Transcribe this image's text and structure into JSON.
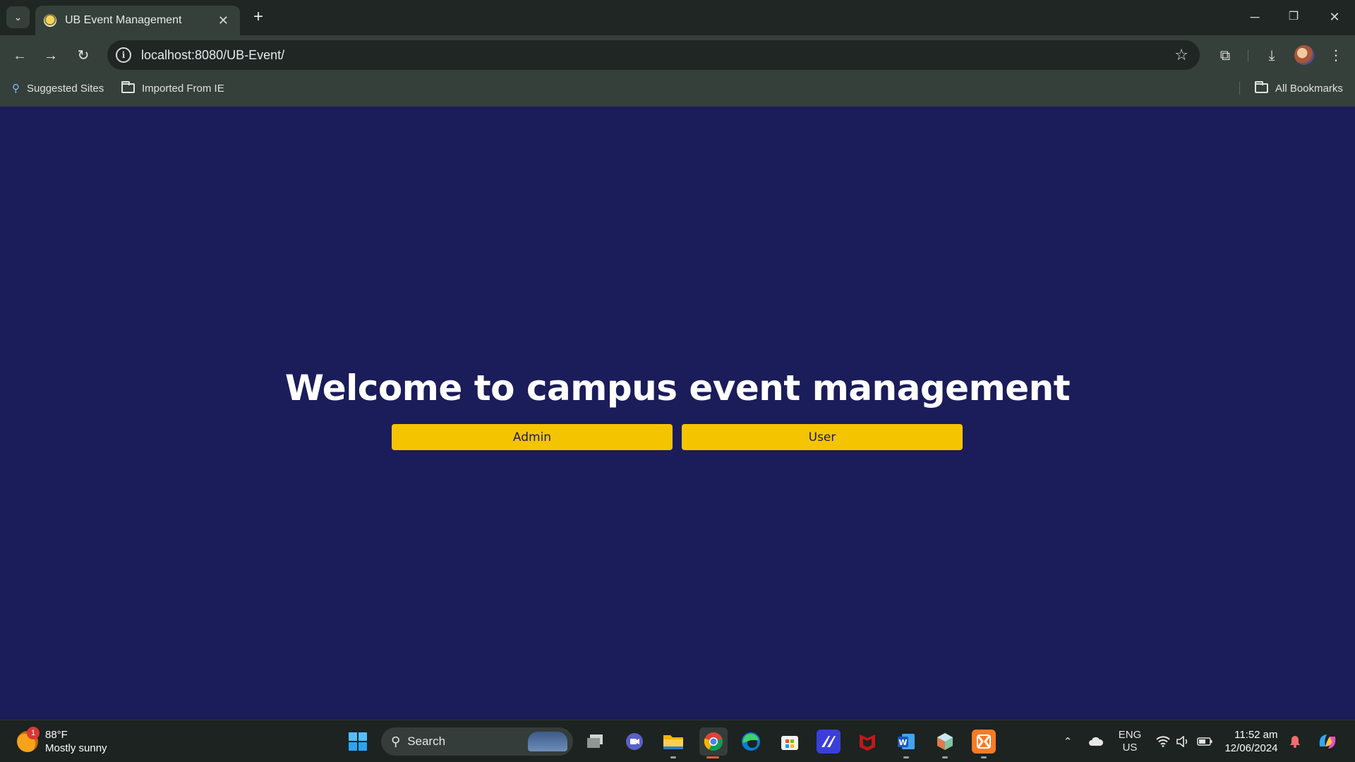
{
  "browser": {
    "tab_title": "UB Event Management",
    "tab_close": "✕",
    "new_tab": "+",
    "url": "localhost:8080/UB-Event/",
    "bookmarks": [
      "Suggested Sites",
      "Imported From IE"
    ],
    "all_bookmarks": "All Bookmarks",
    "window_controls": {
      "minimize": "─",
      "restore": "❐",
      "close": "✕"
    }
  },
  "page": {
    "title": "Welcome to campus event management",
    "buttons": {
      "admin": "Admin",
      "user": "User"
    },
    "colors": {
      "background": "#1b1c5a",
      "button": "#f5c400",
      "title": "#ffffff"
    }
  },
  "taskbar": {
    "weather": {
      "temp": "88°F",
      "condition": "Mostly sunny",
      "badge": "1"
    },
    "search_label": "Search",
    "language": {
      "line1": "ENG",
      "line2": "US"
    },
    "clock": {
      "time": "11:52 am",
      "date": "12/06/2024"
    },
    "apps": [
      "windows-start",
      "search",
      "task-view",
      "meet",
      "file-explorer",
      "chrome",
      "edge",
      "microsoft-store",
      "visual-studio",
      "mcafee",
      "word",
      "app-cube",
      "xampp"
    ]
  }
}
